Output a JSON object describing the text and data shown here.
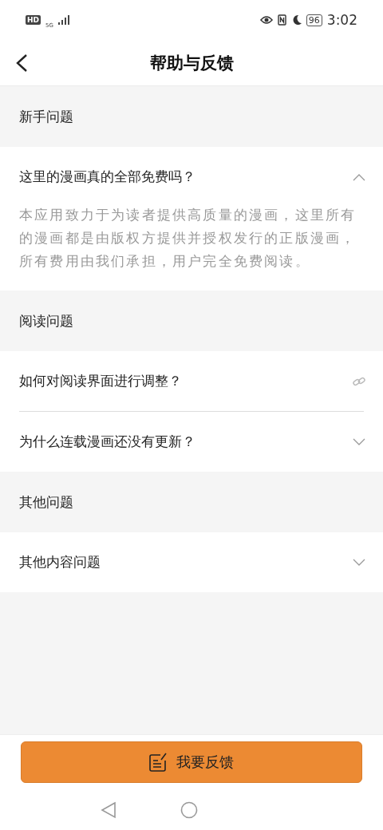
{
  "status_bar": {
    "hd": "HD",
    "network": "5G",
    "battery": "96",
    "time": "3:02"
  },
  "header": {
    "title": "帮助与反馈"
  },
  "sections": [
    {
      "title": "新手问题",
      "items": [
        {
          "kind": "accordion",
          "question": "这里的漫画真的全部免费吗？",
          "expanded": true,
          "answer": "本应用致力于为读者提供高质量的漫画，这里所有的漫画都是由版权方提供并授权发行的正版漫画，所有费用由我们承担，用户完全免费阅读。"
        }
      ]
    },
    {
      "title": "阅读问题",
      "items": [
        {
          "kind": "link",
          "question": "如何对阅读界面进行调整？"
        },
        {
          "kind": "accordion",
          "question": "为什么连载漫画还没有更新？",
          "expanded": false
        }
      ]
    },
    {
      "title": "其他问题",
      "items": [
        {
          "kind": "accordion",
          "question": "其他内容问题",
          "expanded": false
        }
      ]
    }
  ],
  "feedback_button": "我要反馈"
}
